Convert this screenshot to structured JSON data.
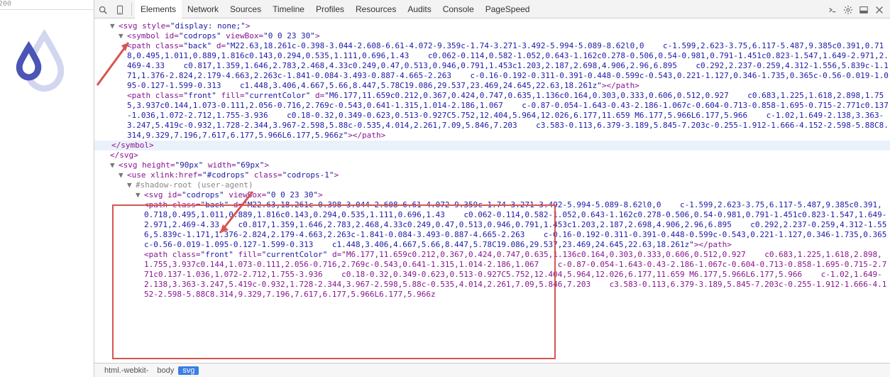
{
  "ruler": {
    "label": "200"
  },
  "tabs": [
    "Elements",
    "Network",
    "Sources",
    "Timeline",
    "Profiles",
    "Resources",
    "Audits",
    "Console",
    "PageSpeed"
  ],
  "active_tab": "Elements",
  "breadcrumb": [
    "html.-webkit-",
    "body",
    "svg"
  ],
  "breadcrumb_sel": "svg",
  "dom": {
    "svg1_open": "<svg style=\"display: none;\">",
    "symbol_open": "<symbol id=\"codrops\" viewBox=\"0 0 23 30\">",
    "path_back1": "<path class=\"back\" d=\"M22.63,18.261c-0.398-3.044-2.608-6.61-4.072-9.359c-1.74-3.271-3.492-5.994-5.089-8.62l0,0    c-1.599,2.623-3.75,6.117-5.487,9.385c0.391,0.718,0.495,1.011,0.889,1.816c0.143,0.294,0.535,1.111,0.696,1.43    c0.062-0.114,0.582-1.052,0.643-1.162c0.278-0.506,0.54-0.981,0.791-1.451c0.823-1.547,1.649-2.971,2.469-4.33    c0.817,1.359,1.646,2.783,2.468,4.33c0.249,0.47,0.513,0.946,0.791,1.453c1.203,2.187,2.698,4.906,2.96,6.895    c0.292,2.237-0.259,4.312-1.556,5.839c-1.171,1.376-2.824,2.179-4.663,2.263c-1.841-0.084-3.493-0.887-4.665-2.263    c-0.16-0.192-0.311-0.391-0.448-0.599c-0.543,0.221-1.127,0.346-1.735,0.365c-0.56-0.019-1.095-0.127-1.599-0.313    c1.448,3.406,4.667,5.66,8.447,5.78C19.086,29.537,23.469,24.645,22.63,18.261z\"></path>",
    "path_front1": "<path class=\"front\" fill=\"currentColor\" d=\"M6.177,11.659c0.212,0.367,0.424,0.747,0.635,1.136c0.164,0.303,0.333,0.606,0.512,0.927    c0.683,1.225,1.618,2.898,1.755,3.937c0.144,1.073-0.111,2.056-0.716,2.769c-0.543,0.641-1.315,1.014-2.186,1.067    c-0.87-0.054-1.643-0.43-2.186-1.067c-0.604-0.713-0.858-1.695-0.715-2.771c0.137-1.036,1.072-2.712,1.755-3.936    c0.18-0.32,0.349-0.623,0.513-0.927C5.752,12.404,5.964,12.026,6.177,11.659 M6.177,5.966L6.177,5.966    c-1.02,1.649-2.138,3.363-3.247,5.419c-0.932,1.728-2.344,3.967-2.598,5.88c-0.535,4.014,2.261,7.09,5.846,7.203    c3.583-0.113,6.379-3.189,5.845-7.203c-0.255-1.912-1.666-4.152-2.598-5.88C8.314,9.329,7.196,7.617,6.177,5.966L6.177,5.966z\"></path>",
    "symbol_close": "</symbol>",
    "svg1_close": "</svg>",
    "svg2_open": "<svg height=\"90px\" width=\"69px\">",
    "use_open": "<use xlink:href=\"#codrops\" class=\"codrops-1\">",
    "shadow": "#shadow-root (user-agent)",
    "svg3_open": "<svg id=\"codrops\" viewBox=\"0 0 23 30\">",
    "path_back2": "<path class=\"back\" d=\"M22.63,18.261c-0.398-3.044-2.608-6.61-4.072-9.359c-1.74-3.271-3.492-5.994-5.089-8.62l0,0    c-1.599,2.623-3.75,6.117-5.487,9.385c0.391,0.718,0.495,1.011,0.889,1.816c0.143,0.294,0.535,1.111,0.696,1.43    c0.062-0.114,0.582-1.052,0.643-1.162c0.278-0.506,0.54-0.981,0.791-1.451c0.823-1.547,1.649-2.971,2.469-4.33    c0.817,1.359,1.646,2.783,2.468,4.33c0.249,0.47,0.513,0.946,0.791,1.453c1.203,2.187,2.698,4.906,2.96,6.895    c0.292,2.237-0.259,4.312-1.556,5.839c-1.171,1.376-2.824,2.179-4.663,2.263c-1.841-0.084-3.493-0.887-4.665-2.263    c-0.16-0.192-0.311-0.391-0.448-0.599c-0.543,0.221-1.127,0.346-1.735,0.365c-0.56-0.019-1.095-0.127-1.599-0.313    c1.448,3.406,4.667,5.66,8.447,5.78C19.086,29.537,23.469,24.645,22.63,18.261z\"></path>",
    "path_front2": "<path class=\"front\" fill=\"currentColor\" d=\"M6.177,11.659c0.212,0.367,0.424,0.747,0.635,1.136c0.164,0.303,0.333,0.606,0.512,0.927    c0.683,1.225,1.618,2.898,1.755,3.937c0.144,1.073-0.111,2.056-0.716,2.769c-0.543,0.641-1.315,1.014-2.186,1.067    c-0.87-0.054-1.643-0.43-2.186-1.067c-0.604-0.713-0.858-1.695-0.715-2.771c0.137-1.036,1.072-2.712,1.755-3.936    c0.18-0.32,0.349-0.623,0.513-0.927C5.752,12.404,5.964,12.026,6.177,11.659 M6.177,5.966L6.177,5.966    c-1.02,1.649-2.138,3.363-3.247,5.419c-0.932,1.728-2.344,3.967-2.598,5.88c-0.535,4.014,2.261,7.09,5.846,7.203    c3.583-0.113,6.379-3.189,5.845-7.203c-0.255-1.912-1.666-4.152-2.598-5.88C8.314,9.329,7.196,7.617,6.177,5.966L6.177,5.966z"
  }
}
